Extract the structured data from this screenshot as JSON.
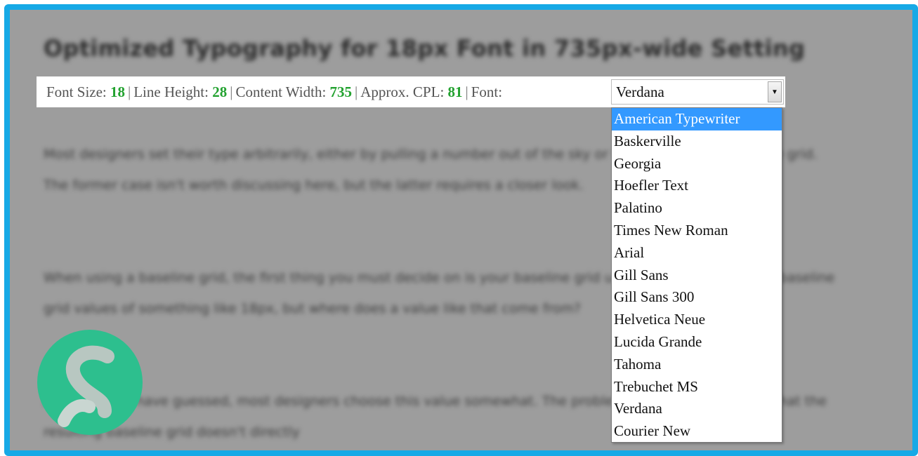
{
  "page": {
    "heading": "Optimized Typography for 18px Font in 735px-wide Setting",
    "paragraphs": [
      "Most designers set their type arbitrarily, either by pulling a number out of the sky or by adhering to a baseline grid. The former case isn't worth discussing here, but the latter requires a closer look.",
      "When using a baseline grid, the first thing you must decide on is your baseline grid unit. You'll commonly see baseline grid values of something like 18px, but where does a value like that come from?",
      "As you might have guessed, most designers choose this value somewhat. The problem with this approach is that the resulting baseline grid doesn't directly"
    ]
  },
  "toolbar": {
    "font_size_label": "Font Size:",
    "font_size_value": "18",
    "line_height_label": "Line Height:",
    "line_height_value": "28",
    "content_width_label": "Content Width:",
    "content_width_value": "735",
    "cpl_label": "Approx. CPL:",
    "cpl_value": "81",
    "font_label": "Font:",
    "font_selected": "Verdana",
    "separator": "|"
  },
  "dropdown": {
    "options": [
      "American Typewriter",
      "Baskerville",
      "Georgia",
      "Hoefler Text",
      "Palatino",
      "Times New Roman",
      "Arial",
      "Gill Sans",
      "Gill Sans 300",
      "Helvetica Neue",
      "Lucida Grande",
      "Tahoma",
      "Trebuchet MS",
      "Verdana",
      "Courier New"
    ],
    "highlighted_index": 0
  },
  "colors": {
    "frame_border": "#16a9e6",
    "number_accent": "#23a230",
    "highlight": "#3399ff",
    "logo": "#2dbf8e"
  },
  "icons": {
    "dropdown_arrow": "triangle-down-icon",
    "logo": "s-logo-icon"
  }
}
